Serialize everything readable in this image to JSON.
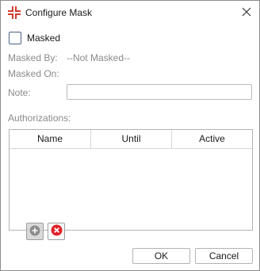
{
  "window": {
    "title": "Configure Mask",
    "app_icon": "mask-configure-icon",
    "close_icon": "close-icon",
    "accent_color": "#d23a2e"
  },
  "form": {
    "masked_label": "Masked",
    "masked_checked": false,
    "masked_by_label": "Masked By:",
    "masked_by_value": "--Not Masked--",
    "masked_on_label": "Masked On:",
    "masked_on_value": "",
    "note_label": "Note:",
    "note_value": "",
    "authorizations_label": "Authorizations:"
  },
  "table": {
    "columns": [
      "Name",
      "Until",
      "Active"
    ],
    "rows": []
  },
  "table_actions": {
    "add_icon": "add-circle-icon",
    "remove_icon": "remove-circle-icon"
  },
  "buttons": {
    "ok_label": "OK",
    "cancel_label": "Cancel"
  }
}
